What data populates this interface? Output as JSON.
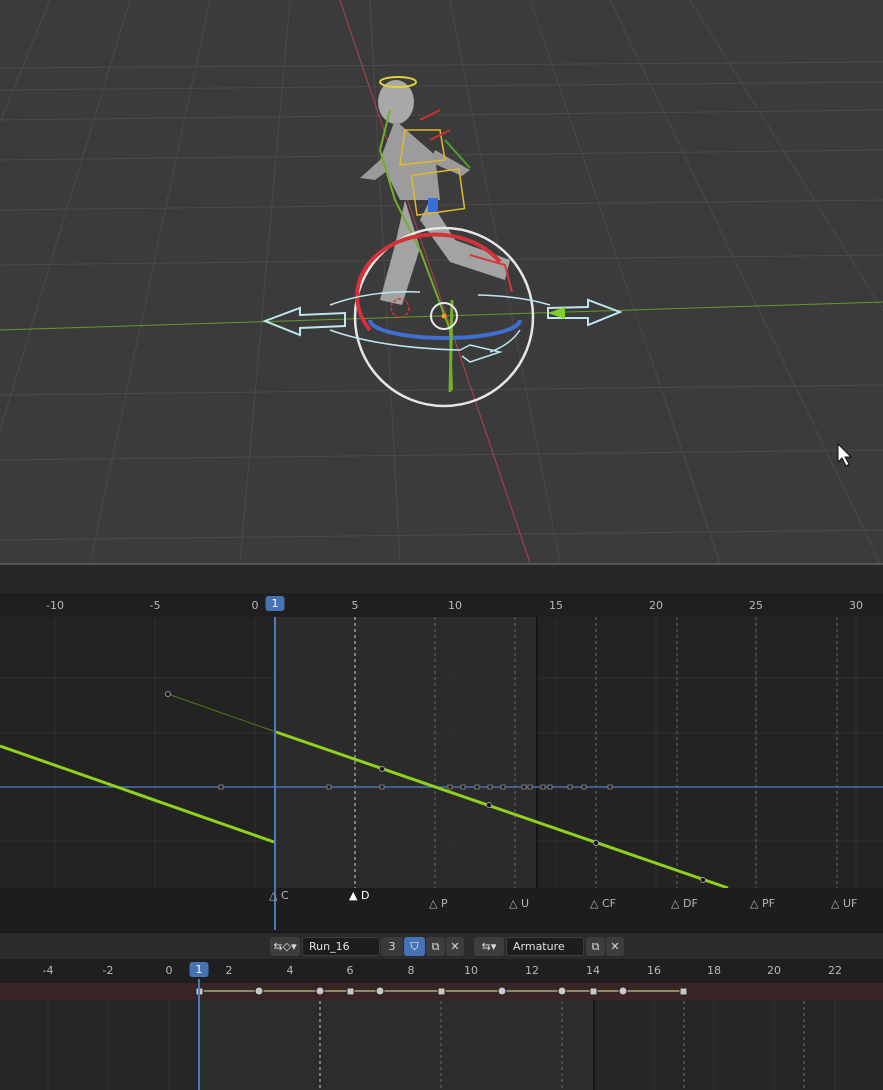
{
  "viewport": {
    "cursor": "mouse-pointer-icon"
  },
  "graph_editor": {
    "ruler": [
      "-10",
      "-5",
      "0",
      "5",
      "10",
      "15",
      "20",
      "25",
      "30"
    ],
    "current_frame": "1",
    "markers": [
      {
        "label": "C",
        "selected": false
      },
      {
        "label": "D",
        "selected": true
      },
      {
        "label": "P",
        "selected": false
      },
      {
        "label": "U",
        "selected": false
      },
      {
        "label": "CF",
        "selected": false
      },
      {
        "label": "DF",
        "selected": false
      },
      {
        "label": "PF",
        "selected": false
      },
      {
        "label": "UF",
        "selected": false
      }
    ],
    "curve_color": "#8fd11c",
    "frame_line_color": "#4a7ac0"
  },
  "action_bar": {
    "action_name": "Run_16",
    "users": "3",
    "armature_name": "Armature"
  },
  "dopesheet": {
    "ruler": [
      "-4",
      "-2",
      "0",
      "2",
      "4",
      "6",
      "8",
      "10",
      "12",
      "14",
      "16",
      "18",
      "20",
      "22"
    ],
    "current_frame": "1"
  },
  "colors": {
    "accent": "#4772b3",
    "viewport_bg": "#3b3b3b",
    "axis_x": "#c8414b",
    "axis_y": "#7fb51f"
  }
}
